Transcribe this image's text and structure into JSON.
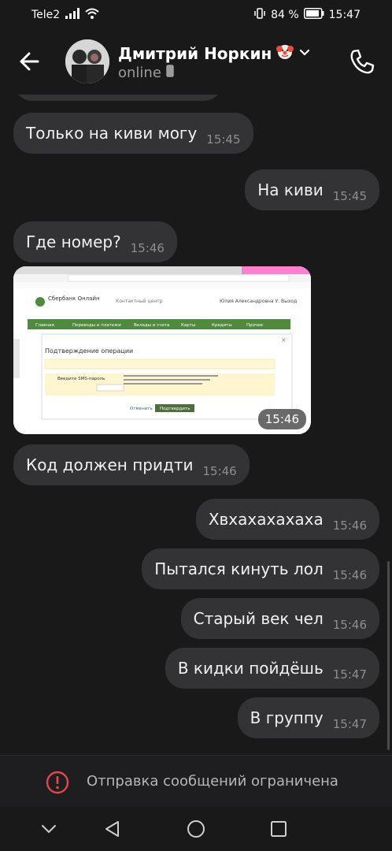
{
  "status_bar": {
    "carrier": "Tele2",
    "battery": "84 %",
    "time": "15:47"
  },
  "header": {
    "contact_name": "Дмитрий Норкин",
    "status": "online"
  },
  "messages": [
    {
      "text": "Только на киви могу",
      "time": "15:45",
      "side": "in"
    },
    {
      "text": "На киви",
      "time": "15:45",
      "side": "out"
    },
    {
      "text": "Где номер?",
      "time": "15:46",
      "side": "in"
    },
    {
      "type": "photo",
      "time": "15:46",
      "side": "in"
    },
    {
      "text": "Код должен придти",
      "time": "15:46",
      "side": "in"
    },
    {
      "text": "Хвхахахахаха",
      "time": "15:46",
      "side": "out"
    },
    {
      "text": "Пытался кинуть лол",
      "time": "15:46",
      "side": "out"
    },
    {
      "text": "Старый век чел",
      "time": "15:46",
      "side": "out"
    },
    {
      "text": "В кидки пойдёшь",
      "time": "15:47",
      "side": "out"
    },
    {
      "text": "В группу",
      "time": "15:47",
      "side": "out"
    }
  ],
  "photo": {
    "site_logo": "Сбербанк Онлайн",
    "dialog_title": "Подтверждение операции",
    "sms_label": "Введите SMS-пароль",
    "cancel_label": "Отменить",
    "confirm_label": "Подтвердить",
    "nav": [
      "Главная",
      "Переводы и платежи",
      "Вклады и счета",
      "Карты",
      "Кредиты",
      "Прочее"
    ]
  },
  "footer": {
    "restriction_text": "Отправка сообщений ограничена"
  },
  "colors": {
    "background": "#19191a",
    "bubble": "#333336",
    "restriction_icon": "#e0484f",
    "sber_green": "#4f8a3d"
  }
}
